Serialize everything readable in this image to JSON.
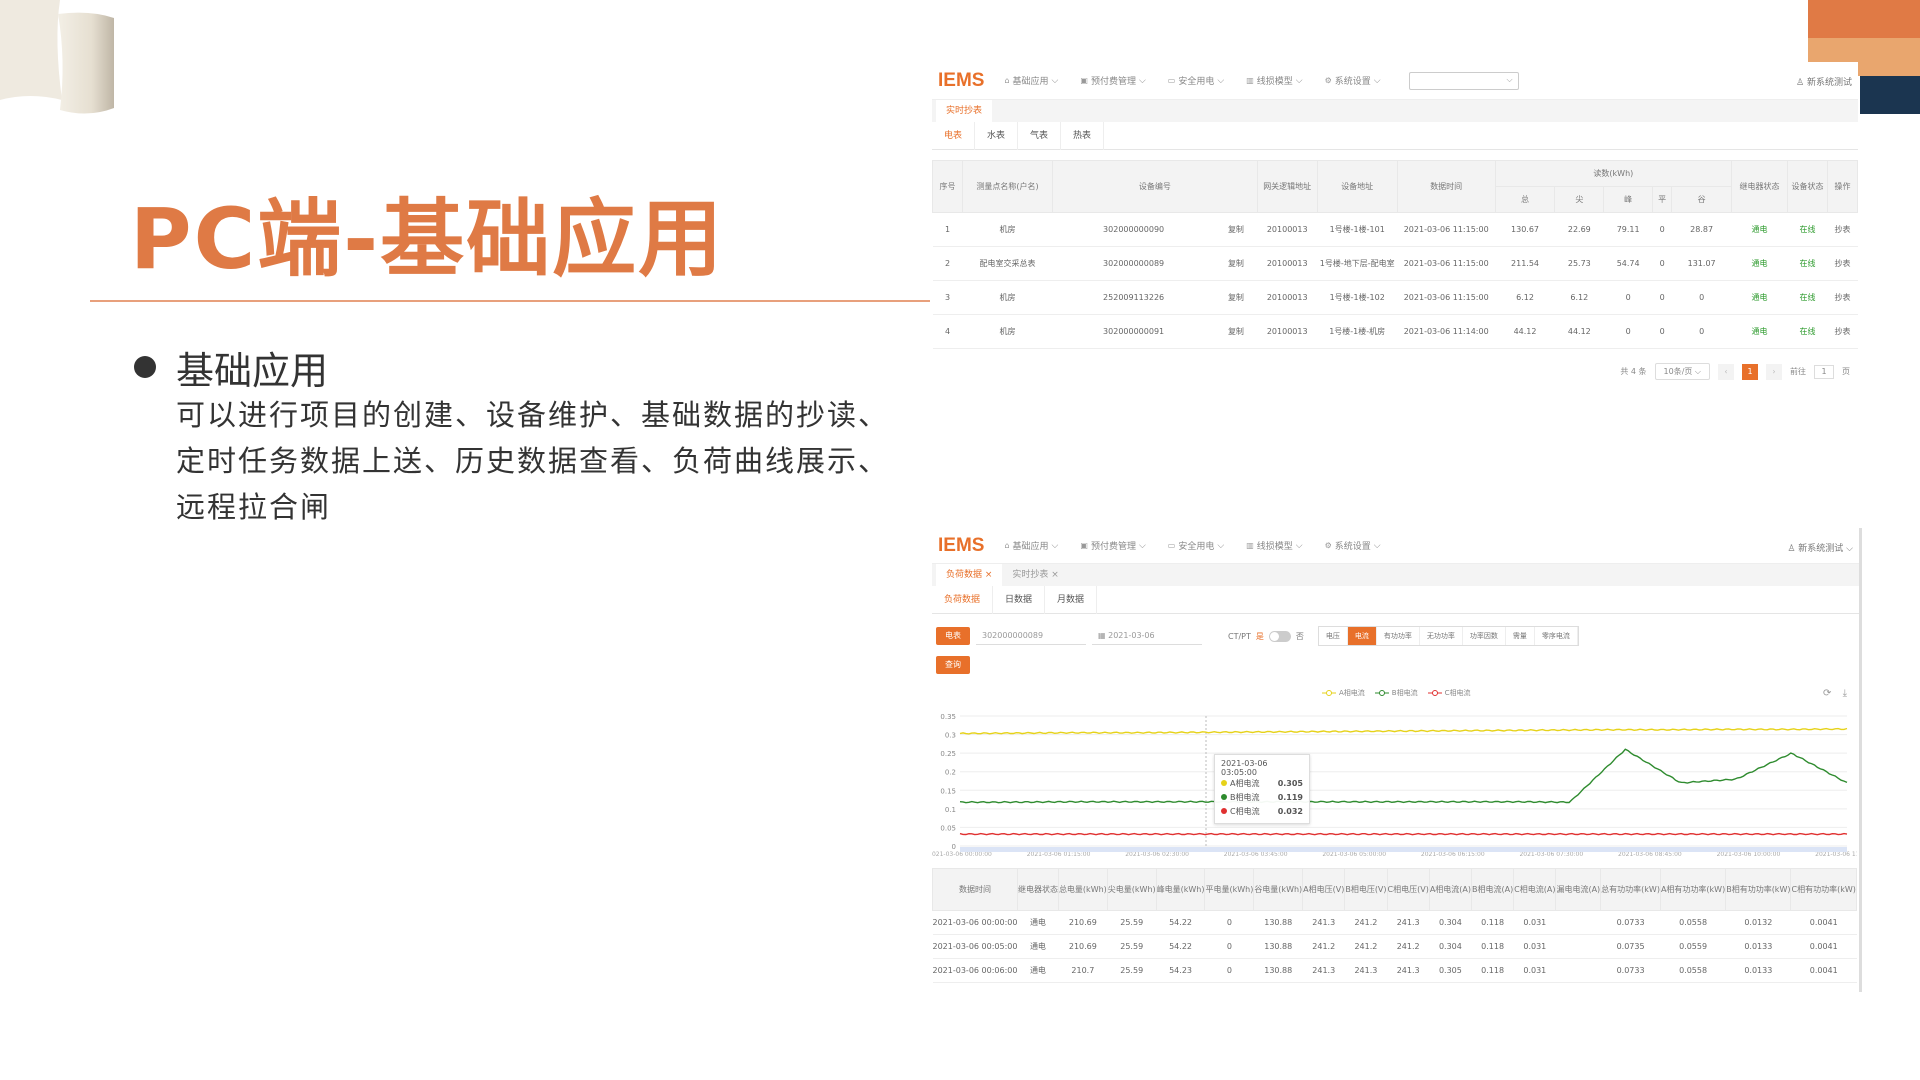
{
  "slide": {
    "title": "PC端-基础应用",
    "bullet_heading": "基础应用",
    "bullet_text": "可以进行项目的创建、设备维护、基础数据的抄读、定时任务数据上送、历史数据查看、负荷曲线展示、远程拉合闸"
  },
  "colors": {
    "accent": "#e8702a",
    "title": "#df7a45",
    "navy": "#1b3550",
    "green": "#2e9b2e"
  },
  "app": {
    "logo": "IEMS",
    "nav": [
      {
        "icon": "home-icon",
        "label": "基础应用"
      },
      {
        "icon": "prepay-icon",
        "label": "预付费管理"
      },
      {
        "icon": "safety-icon",
        "label": "安全用电"
      },
      {
        "icon": "chart-icon",
        "label": "线损模型"
      },
      {
        "icon": "gear-icon",
        "label": "系统设置"
      }
    ],
    "user": "新系统测试"
  },
  "shot1": {
    "tag": "实时抄表",
    "tabs": [
      "电表",
      "水表",
      "气表",
      "热表"
    ],
    "headers": [
      "序号",
      "测量点名称(户名)",
      "设备编号",
      "网关逻辑地址",
      "设备地址",
      "数据时间",
      "读数(kWh)",
      "继电器状态",
      "设备状态",
      "操作"
    ],
    "sub_headers": [
      "总",
      "尖",
      "峰",
      "平",
      "谷"
    ],
    "rows": [
      [
        "1",
        "机房",
        "302000000090",
        "复制",
        "20100013",
        "1号楼-1楼-101",
        "2021-03-06 11:15:00",
        "130.67",
        "22.69",
        "79.11",
        "0",
        "28.87",
        "通电",
        "在线",
        "抄表"
      ],
      [
        "2",
        "配电室交采总表",
        "302000000089",
        "复制",
        "20100013",
        "1号楼-地下层-配电室",
        "2021-03-06 11:15:00",
        "211.54",
        "25.73",
        "54.74",
        "0",
        "131.07",
        "通电",
        "在线",
        "抄表"
      ],
      [
        "3",
        "机房",
        "252009113226",
        "复制",
        "20100013",
        "1号楼-1楼-102",
        "2021-03-06 11:15:00",
        "6.12",
        "6.12",
        "0",
        "0",
        "0",
        "通电",
        "在线",
        "抄表"
      ],
      [
        "4",
        "机房",
        "302000000091",
        "复制",
        "20100013",
        "1号楼-1楼-机房",
        "2021-03-06 11:14:00",
        "44.12",
        "44.12",
        "0",
        "0",
        "0",
        "通电",
        "在线",
        "抄表"
      ]
    ],
    "pager": {
      "total": "共 4 条",
      "page_size": "10条/页",
      "current": "1",
      "goto_label": "前往",
      "goto_value": "1",
      "page_unit": "页"
    }
  },
  "shot2": {
    "tags": [
      "负荷数据 ×",
      "实时抄表 ×"
    ],
    "tabs": [
      "负荷数据",
      "日数据",
      "月数据"
    ],
    "device_btn": "电表",
    "device_value": "302000000089",
    "date_value": "2021-03-06",
    "ctpt_label": "CT/PT",
    "ctpt_yes": "是",
    "ctpt_no": "否",
    "modes": [
      "电压",
      "电流",
      "有功功率",
      "无功功率",
      "功率因数",
      "需量",
      "零序电流"
    ],
    "query_btn": "查询",
    "tools": "⟳ ⤓",
    "tooltip": {
      "time": "2021-03-06 03:05:00",
      "items": [
        {
          "name": "A相电流",
          "value": "0.305",
          "color": "#e6d21a"
        },
        {
          "name": "B相电流",
          "value": "0.119",
          "color": "#2e8b2e"
        },
        {
          "name": "C相电流",
          "value": "0.032",
          "color": "#e03030"
        }
      ]
    },
    "table_headers": [
      "数据时间",
      "继电器状态",
      "总电量(kWh)",
      "尖电量(kWh)",
      "峰电量(kWh)",
      "平电量(kWh)",
      "谷电量(kWh)",
      "A相电压(V)",
      "B相电压(V)",
      "C相电压(V)",
      "A相电流(A)",
      "B相电流(A)",
      "C相电流(A)",
      "漏电电流(A)",
      "总有功功率(kW)",
      "A相有功功率(kW)",
      "B相有功功率(kW)",
      "C相有功功率(kW)"
    ],
    "table_rows": [
      [
        "2021-03-06 00:00:00",
        "通电",
        "210.69",
        "25.59",
        "54.22",
        "0",
        "130.88",
        "241.3",
        "241.2",
        "241.3",
        "0.304",
        "0.118",
        "0.031",
        "",
        "0.0733",
        "0.0558",
        "0.0132",
        "0.0041"
      ],
      [
        "2021-03-06 00:05:00",
        "通电",
        "210.69",
        "25.59",
        "54.22",
        "0",
        "130.88",
        "241.2",
        "241.2",
        "241.2",
        "0.304",
        "0.118",
        "0.031",
        "",
        "0.0735",
        "0.0559",
        "0.0133",
        "0.0041"
      ],
      [
        "2021-03-06 00:06:00",
        "通电",
        "210.7",
        "25.59",
        "54.23",
        "0",
        "130.88",
        "241.3",
        "241.3",
        "241.3",
        "0.305",
        "0.118",
        "0.031",
        "",
        "0.0733",
        "0.0558",
        "0.0133",
        "0.0041"
      ]
    ]
  },
  "chart_data": {
    "type": "line",
    "title": "",
    "xlabel": "",
    "ylabel": "",
    "ylim": [
      0,
      0.35
    ],
    "y_ticks": [
      "0",
      "0.05",
      "0.1",
      "0.15",
      "0.2",
      "0.25",
      "0.3",
      "0.35"
    ],
    "x_ticks": [
      "2021-03-06 00:00:00",
      "2021-03-06 01:15:00",
      "2021-03-06 02:30:00",
      "2021-03-06 03:45:00",
      "2021-03-06 05:00:00",
      "2021-03-06 06:15:00",
      "2021-03-06 07:30:00",
      "2021-03-06 08:45:00",
      "2021-03-06 10:00:00",
      "2021-03-06 11:15:00"
    ],
    "legend": [
      "A相电流",
      "B相电流",
      "C相电流"
    ],
    "legend_position": "top-center",
    "series": [
      {
        "name": "A相电流",
        "color": "#e6d21a",
        "values": [
          0.303,
          0.304,
          0.305,
          0.305,
          0.306,
          0.307,
          0.308,
          0.309,
          0.31,
          0.311,
          0.312,
          0.313,
          0.313,
          0.314,
          0.314,
          0.315
        ]
      },
      {
        "name": "B相电流",
        "color": "#2e8b2e",
        "values": [
          0.118,
          0.118,
          0.119,
          0.119,
          0.119,
          0.119,
          0.119,
          0.119,
          0.119,
          0.119,
          0.119,
          0.118,
          0.26,
          0.17,
          0.18,
          0.25,
          0.17
        ]
      },
      {
        "name": "C相电流",
        "color": "#e03030",
        "values": [
          0.032,
          0.032,
          0.032,
          0.032,
          0.032,
          0.032,
          0.032,
          0.032,
          0.032,
          0.032,
          0.032,
          0.032,
          0.032,
          0.032,
          0.032,
          0.032
        ]
      }
    ]
  }
}
